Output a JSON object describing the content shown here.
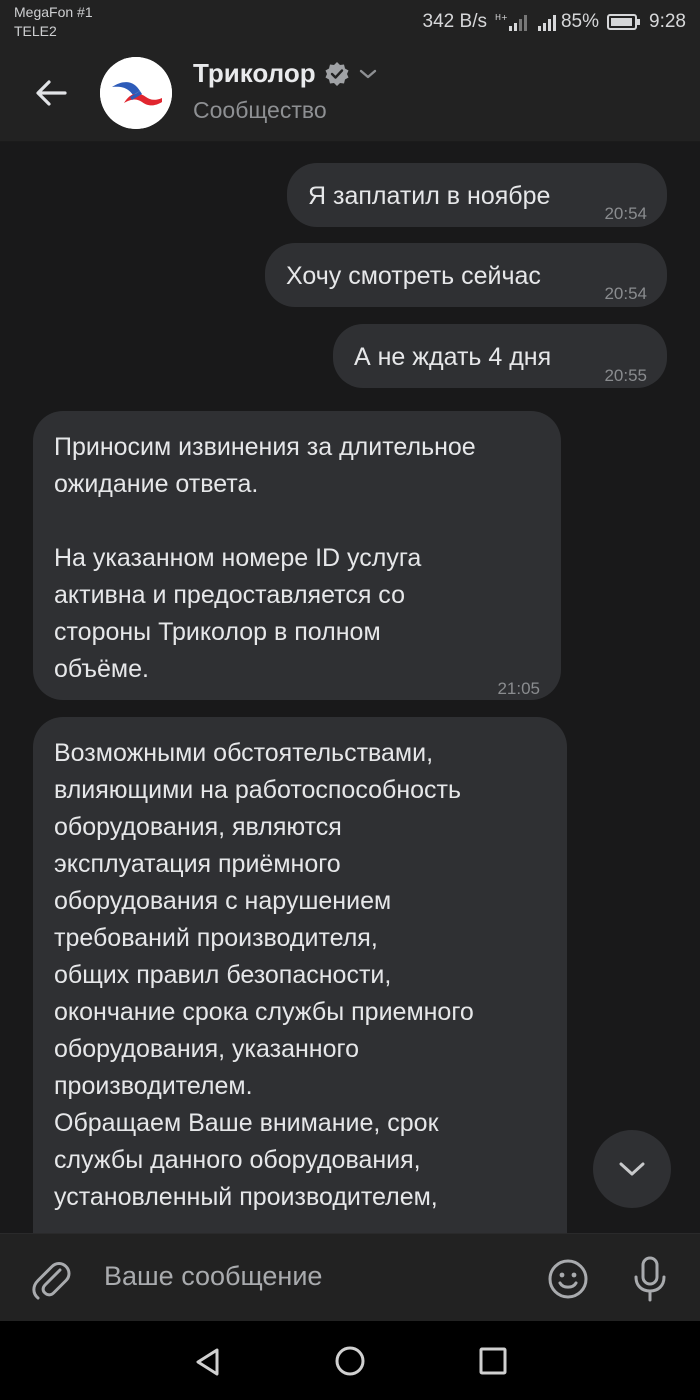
{
  "status_bar": {
    "carrier_1": "MegaFon #1",
    "carrier_2": "TELE2",
    "network_speed": "342 B/s",
    "battery": "85%",
    "time": "9:28"
  },
  "header": {
    "title": "Триколор",
    "subtitle": "Сообщество",
    "verified": true
  },
  "messages": [
    {
      "direction": "out",
      "text": "Я заплатил в ноябре",
      "time": "20:54"
    },
    {
      "direction": "out",
      "text": "Хочу смотреть сейчас",
      "time": "20:54"
    },
    {
      "direction": "out",
      "text": "А не ждать 4 дня",
      "time": "20:55"
    },
    {
      "direction": "in",
      "text": "Приносим извинения за длительное\nожидание ответа.\n\nНа указанном номере ID услуга\nактивна и предоставляется со\nстороны Триколор в полном\nобъёме.",
      "time": "21:05"
    },
    {
      "direction": "in",
      "text": "Возможными обстоятельствами,\nвлияющими на работоспособность\nоборудования, являются\nэксплуатация приёмного\nоборудования с нарушением\nтребований производителя,\nобщих правил безопасности,\nокончание срока службы приемного\nоборудования, указанного\nпроизводителем.\nОбращаем Ваше внимание, срок\nслужбы данного оборудования,\nустановленный производителем,",
      "time": ""
    }
  ],
  "composer": {
    "placeholder": "Ваше сообщение"
  },
  "icons": {
    "back": "arrow-left-icon",
    "verified": "verified-badge-icon",
    "dropdown": "chevron-down-icon",
    "scroll_down": "chevron-down-icon",
    "attach": "paperclip-icon",
    "emoji": "smile-icon",
    "mic": "microphone-icon"
  },
  "colors": {
    "background": "#19191a",
    "bubble": "#2f3033",
    "header": "#222222",
    "brand_blue": "#2d5bb9",
    "brand_red": "#e1262f"
  }
}
